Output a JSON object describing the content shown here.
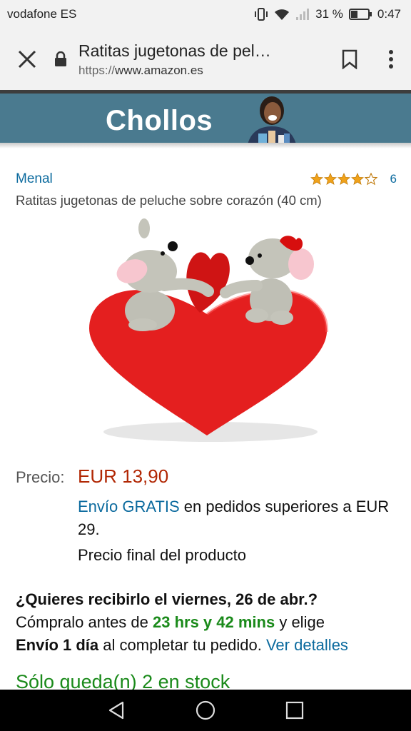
{
  "status_bar": {
    "carrier": "vodafone ES",
    "battery": "31 %",
    "time": "0:47"
  },
  "browser": {
    "page_title": "Ratitas jugetonas de pel…",
    "url_scheme": "https://",
    "url_host": "www.amazon.es"
  },
  "banner": {
    "text": "Chollos"
  },
  "product": {
    "brand": "Menal",
    "rating": 4,
    "review_count": "6",
    "title": "Ratitas jugetonas de peluche sobre corazón (40 cm)",
    "price_label": "Precio:",
    "price": "EUR 13,90",
    "shipping_link": "Envío GRATIS",
    "shipping_text": " en pedidos superiores a EUR 29.",
    "final_price_text": "Precio final del producto"
  },
  "delivery": {
    "question": "¿Quieres recibirlo el viernes, 26 de abr.?",
    "order_before": "Cómpralo antes de ",
    "countdown": "23 hrs y 42 mins",
    "choose": " y elige",
    "option": "Envío 1 día",
    "complete": " al completar tu pedido. ",
    "details_link": "Ver detalles"
  },
  "stock": "Sólo queda(n) 2 en stock",
  "colors": {
    "link": "#0b6a9e",
    "price": "#b12704",
    "in_stock": "#1a8a1a",
    "banner": "#4a7a8f",
    "star": "#f0a21a"
  },
  "icons": [
    "wifi-icon",
    "signal-icon",
    "battery-icon",
    "vibrate-icon",
    "close-icon",
    "lock-icon",
    "bookmark-icon",
    "more-vert-icon",
    "back-icon",
    "home-icon",
    "recents-icon",
    "star-icon"
  ]
}
